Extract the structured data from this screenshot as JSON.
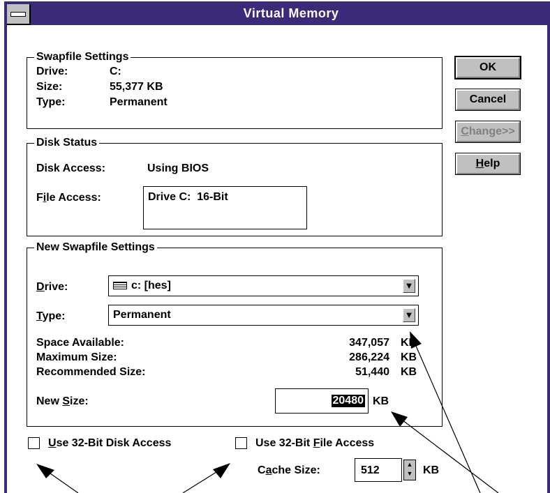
{
  "window": {
    "title": "Virtual Memory"
  },
  "buttons": {
    "ok": "OK",
    "cancel": "Cancel",
    "change": "Change>>",
    "help": "Help"
  },
  "swapfile": {
    "legend": "Swapfile Settings",
    "drive_label": "Drive:",
    "drive_value": "C:",
    "size_label": "Size:",
    "size_value": "55,377 KB",
    "type_label": "Type:",
    "type_value": "Permanent"
  },
  "disk_status": {
    "legend": "Disk Status",
    "disk_access_label": "Disk Access:",
    "disk_access_value": "Using BIOS",
    "file_access_label": "File Access:",
    "file_access_value": "Drive C:  16-Bit"
  },
  "new_swapfile": {
    "legend": "New Swapfile Settings",
    "drive_label": "Drive:",
    "drive_value": "c: [hes]",
    "type_label": "Type:",
    "type_value": "Permanent",
    "space_available_label": "Space Available:",
    "space_available_value": "347,057",
    "maximum_size_label": "Maximum Size:",
    "maximum_size_value": "286,224",
    "recommended_size_label": "Recommended Size:",
    "recommended_size_value": "51,440",
    "unit": "KB",
    "new_size_label": "New Size:",
    "new_size_value": "20480"
  },
  "options": {
    "disk_32bit": "Use 32-Bit Disk Access",
    "file_32bit": "Use 32-Bit File Access",
    "cache_size_label": "Cache Size:",
    "cache_size_value": "512",
    "cache_unit": "KB"
  },
  "colors": {
    "titlebar": "#3a2a78",
    "button_face": "#c0c0c0"
  }
}
